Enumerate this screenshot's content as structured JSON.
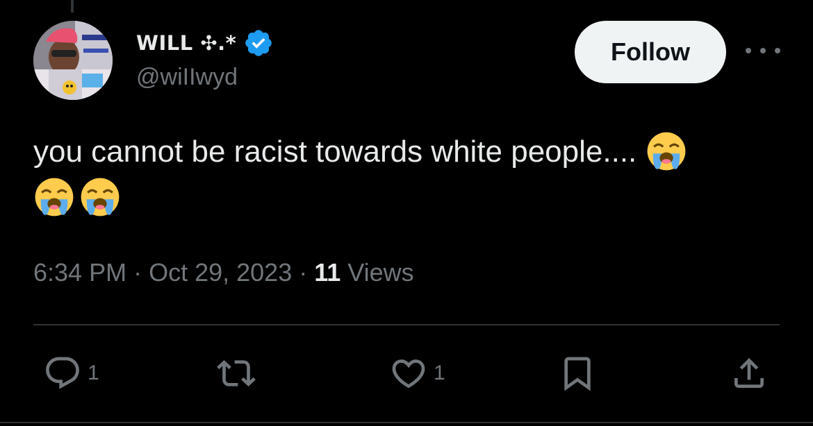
{
  "author": {
    "display_name": "WILL ✣.*",
    "handle": "@wiIIwyd",
    "verified": true
  },
  "follow_label": "Follow",
  "tweet": {
    "text": "you cannot be racist towards white people....",
    "emoji": "loudly-crying-face",
    "emoji_count": 3
  },
  "meta": {
    "time": "6:34 PM",
    "sep1": " · ",
    "date": "Oct 29, 2023",
    "sep2": " · ",
    "views_count": "11",
    "views_label": " Views"
  },
  "actions": {
    "replies": "1",
    "likes": "1"
  },
  "colors": {
    "background": "#000000",
    "text": "#e7e9ea",
    "secondary": "#71767b",
    "verified_blue": "#1d9bf0",
    "button_bg": "#eff3f4",
    "divider": "#2f3336"
  },
  "icons": {
    "verified": "verified-badge-icon",
    "more": "more-options-icon",
    "reply": "reply-icon",
    "retweet": "retweet-icon",
    "like": "heart-icon",
    "bookmark": "bookmark-icon",
    "share": "share-icon"
  }
}
